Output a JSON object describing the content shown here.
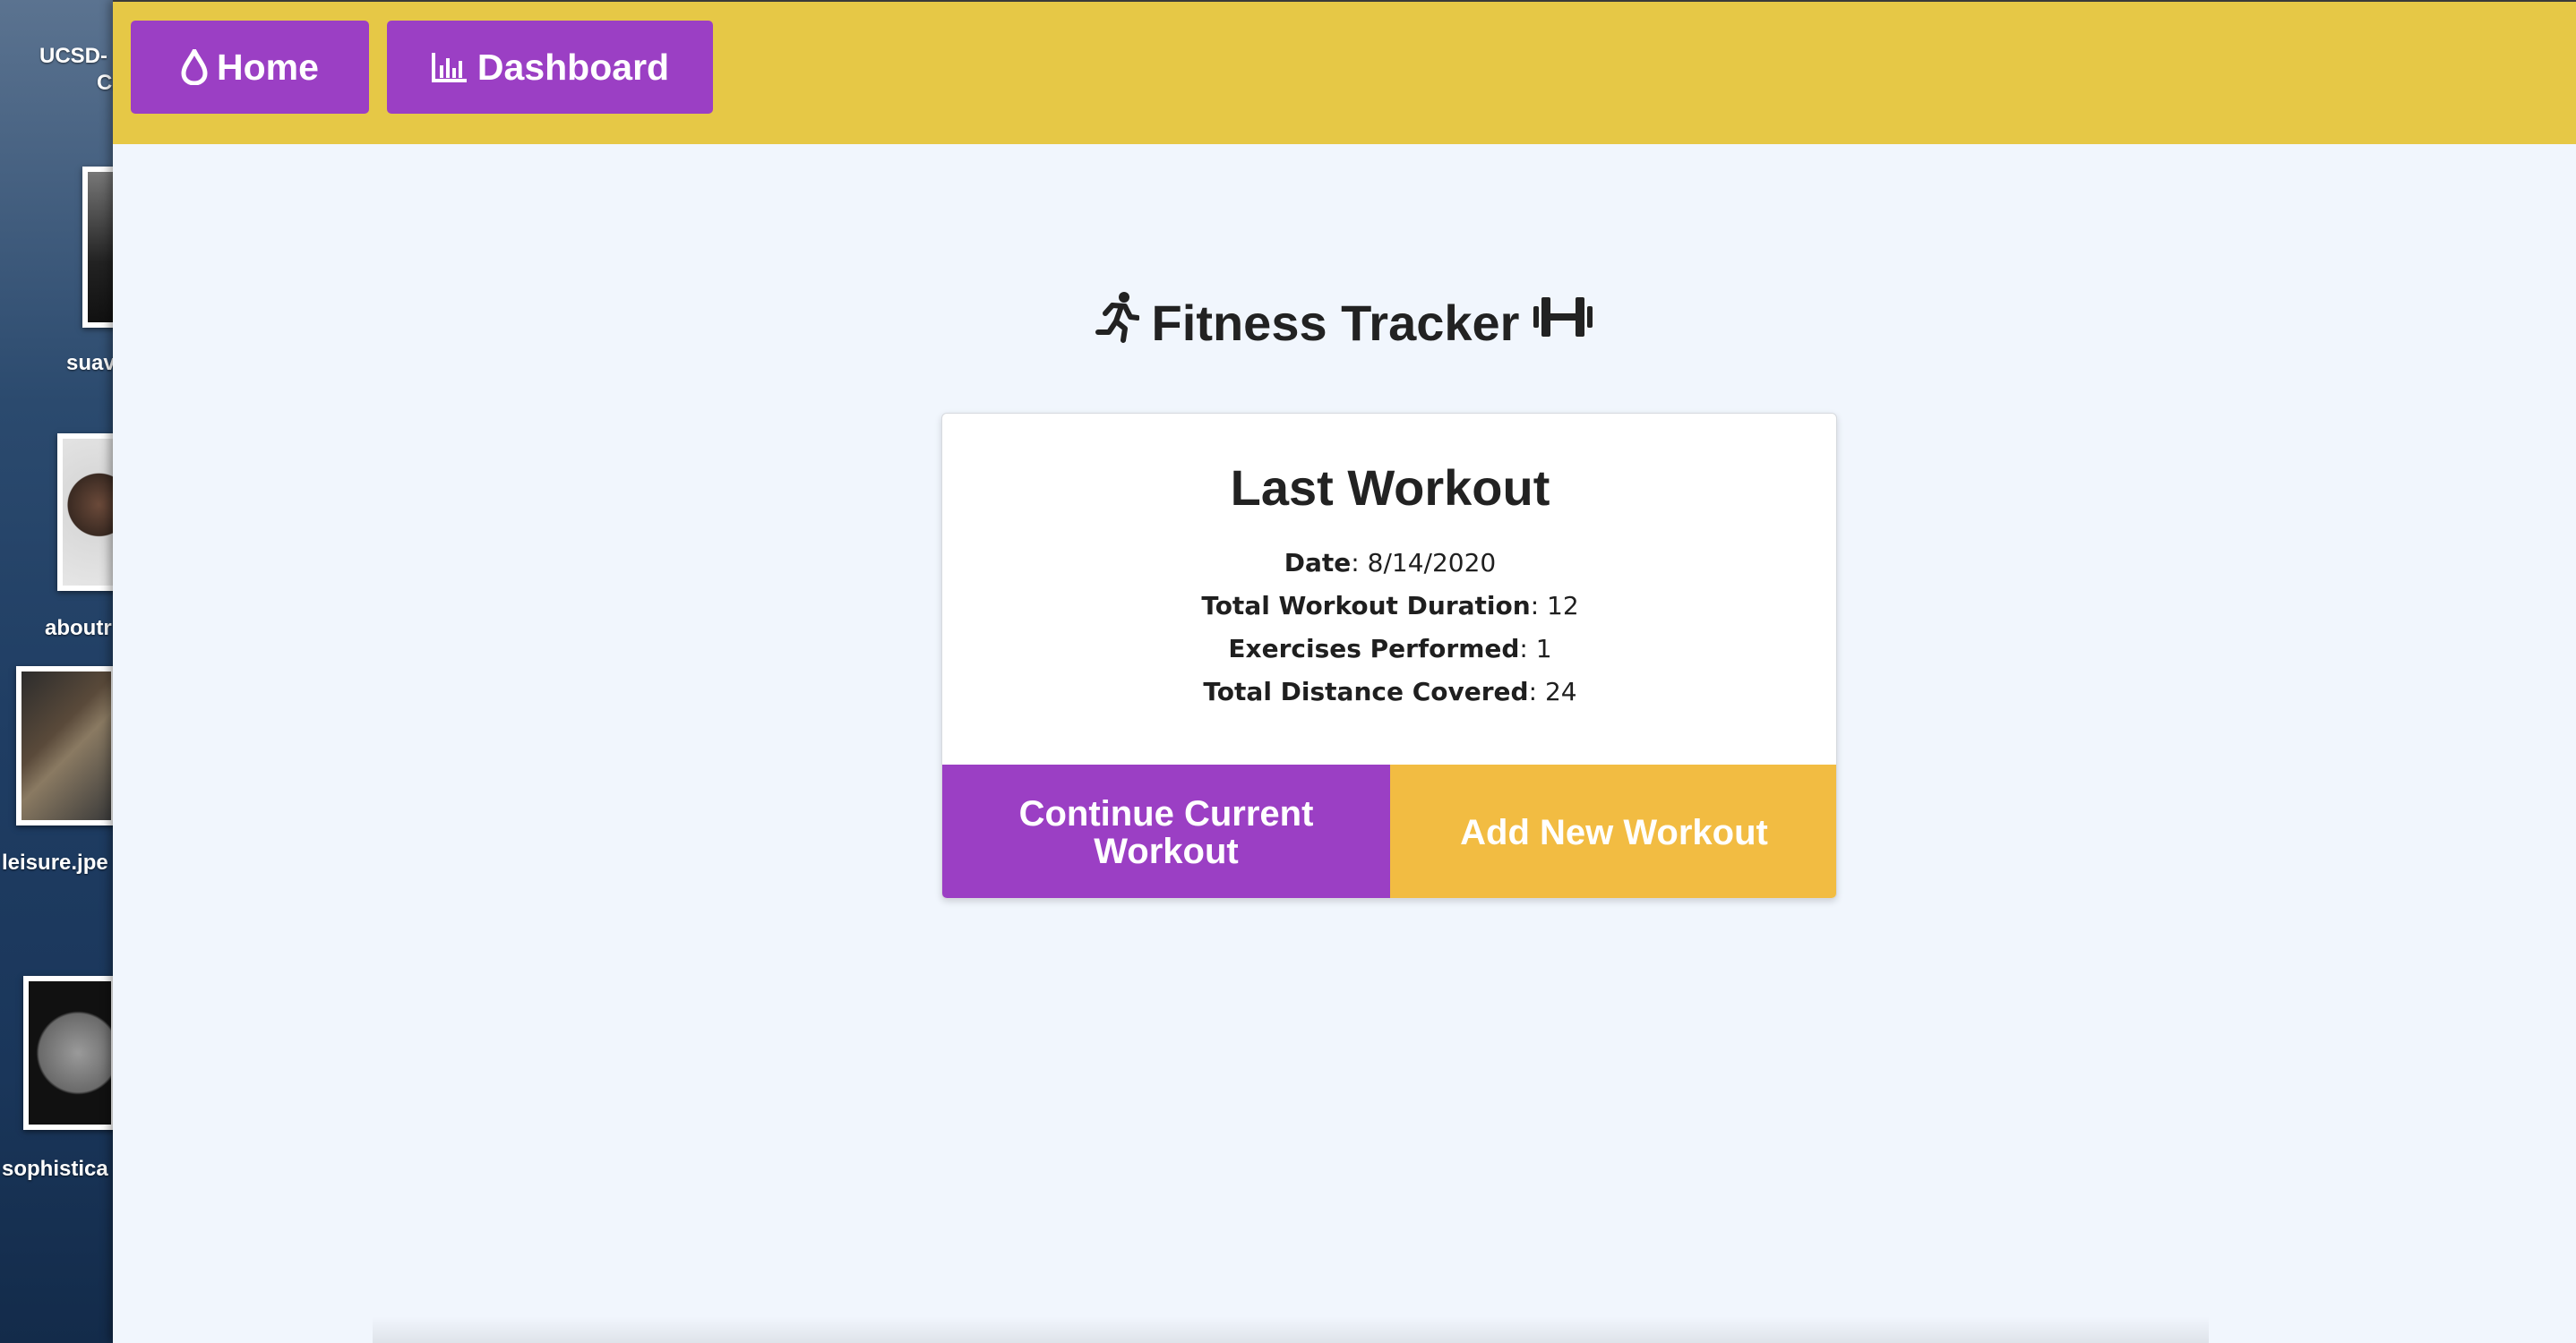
{
  "desktop": {
    "items": [
      {
        "label_line1": "UCSD-",
        "label_line2": "CA"
      },
      {
        "label": "suav"
      },
      {
        "label": "aboutr"
      },
      {
        "label": "leisure.jpe"
      },
      {
        "label": "sophistica"
      }
    ]
  },
  "navbar": {
    "home_label": "Home",
    "dashboard_label": "Dashboard",
    "icons": {
      "home": "droplet-icon",
      "dashboard": "bar-chart-icon"
    }
  },
  "page": {
    "title": "Fitness Tracker",
    "title_icons": [
      "running-icon",
      "dumbbell-icon"
    ]
  },
  "last_workout": {
    "heading": "Last Workout",
    "stats": [
      {
        "label": "Date",
        "value": "8/14/2020"
      },
      {
        "label": "Total Workout Duration",
        "value": "12"
      },
      {
        "label": "Exercises Performed",
        "value": "1"
      },
      {
        "label": "Total Distance Covered",
        "value": "24"
      }
    ],
    "continue_label": "Continue Current Workout",
    "add_label": "Add New Workout"
  },
  "colors": {
    "navbar": "#e6c846",
    "primary_purple": "#9b3fc4",
    "accent_yellow": "#f2bc42",
    "page_background": "#f1f6fd"
  }
}
